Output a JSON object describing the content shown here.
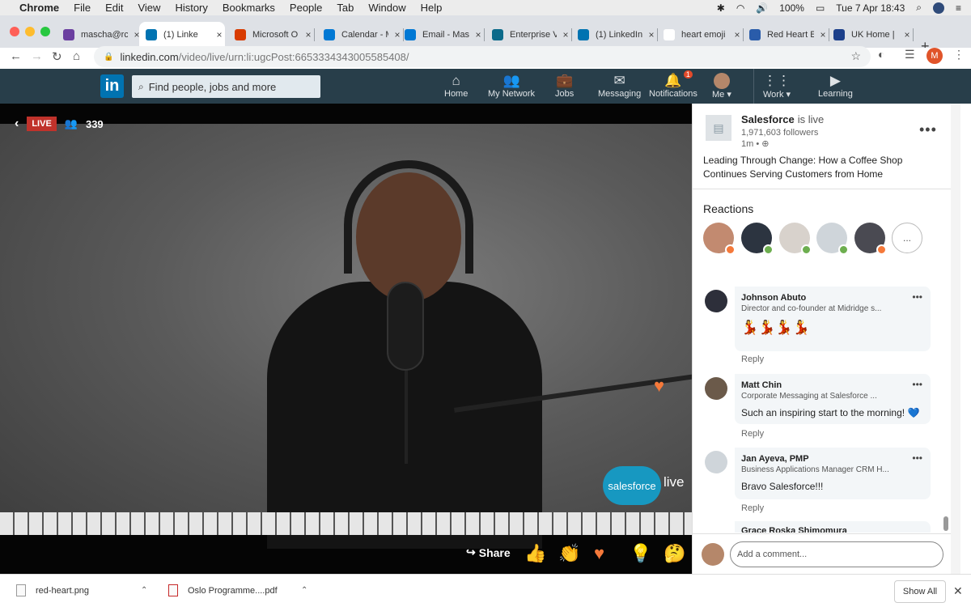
{
  "menubar": {
    "items": [
      "Chrome",
      "File",
      "Edit",
      "View",
      "History",
      "Bookmarks",
      "People",
      "Tab",
      "Window",
      "Help"
    ],
    "battery": "100%",
    "datetime": "Tue 7 Apr  18:43"
  },
  "tabs": [
    {
      "title": "mascha@rc",
      "icon": "mail-icon",
      "color": "#6b3fa0"
    },
    {
      "title": "(1) Linke",
      "icon": "linkedin-icon",
      "color": "#0073b1"
    },
    {
      "title": "Microsoft O",
      "icon": "office-icon",
      "color": "#d83b01"
    },
    {
      "title": "Calendar - M",
      "icon": "calendar-icon",
      "color": "#0078d4"
    },
    {
      "title": "Email - Mas",
      "icon": "outlook-icon",
      "color": "#0078d4"
    },
    {
      "title": "Enterprise V",
      "icon": "enterprise-icon",
      "color": "#0b6a8a"
    },
    {
      "title": "(1) LinkedIn",
      "icon": "linkedin-icon",
      "color": "#0073b1"
    },
    {
      "title": "heart emoji",
      "icon": "google-icon",
      "color": "#ffffff"
    },
    {
      "title": "Red Heart E",
      "icon": "emojipedia-icon",
      "color": "#2a5caa"
    },
    {
      "title": "UK Home |",
      "icon": "uk-icon",
      "color": "#1b3f8b"
    }
  ],
  "address": {
    "host": "linkedin.com",
    "path": "/video/live/urn:li:ugcPost:6653334343005585408/",
    "profile_initial": "M"
  },
  "linkedin": {
    "logo": "in",
    "search_placeholder": "Find people, jobs and more",
    "nav": [
      {
        "label": "Home",
        "icon": "home-icon"
      },
      {
        "label": "My Network",
        "icon": "network-icon"
      },
      {
        "label": "Jobs",
        "icon": "jobs-icon"
      },
      {
        "label": "Messaging",
        "icon": "messaging-icon"
      },
      {
        "label": "Notifications",
        "icon": "bell-icon",
        "badge": "1"
      },
      {
        "label": "Me ▾",
        "icon": "avatar-icon"
      },
      {
        "label": "Work ▾",
        "icon": "grid-icon"
      },
      {
        "label": "Learning",
        "icon": "learning-icon"
      }
    ]
  },
  "video": {
    "live_label": "LIVE",
    "viewers": "339",
    "brand": "salesforce",
    "brand_live": "live",
    "share_label": "Share"
  },
  "panel": {
    "company": "Salesforce",
    "status": "is live",
    "followers": "1,971,603 followers",
    "time": "1m •",
    "post_title": "Leading Through Change: How a Coffee Shop Continues Serving Customers from Home",
    "reactions_heading": "Reactions",
    "reaction_more": "...",
    "comments": [
      {
        "name": "Johnson Abuto",
        "headline": "Director and co-founder at Midridge s...",
        "text": "💃💃💃💃",
        "reply": "Reply"
      },
      {
        "name": "Matt Chin",
        "headline": "Corporate Messaging at Salesforce ...",
        "text": "Such an inspiring start to the morning! 💙",
        "reply": "Reply"
      },
      {
        "name": "Jan Ayeva, PMP",
        "headline": "Business Applications Manager CRM H...",
        "text": "Bravo Salesforce!!!",
        "reply": "Reply"
      },
      {
        "name": "Grace Roska Shimomura",
        "headline": "",
        "text": "",
        "reply": ""
      }
    ],
    "comment_placeholder": "Add a comment..."
  },
  "downloads": {
    "files": [
      "red-heart.png",
      "Oslo Programme....pdf"
    ],
    "show_all": "Show All"
  }
}
